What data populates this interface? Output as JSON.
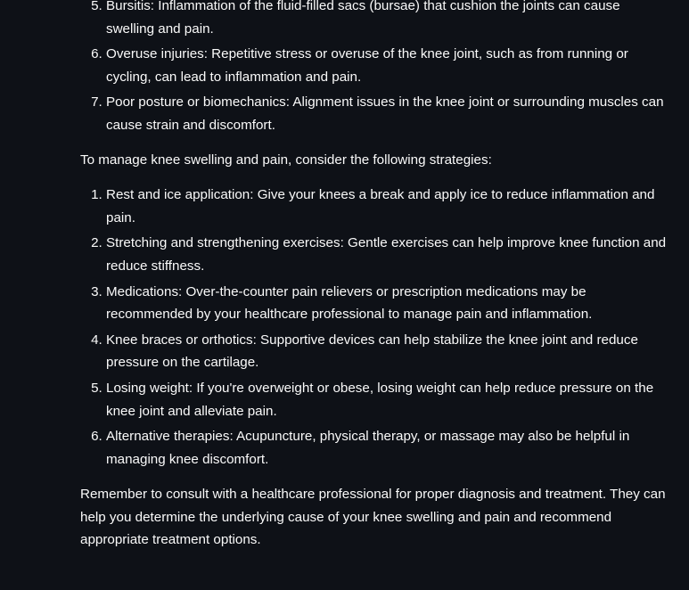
{
  "causes_list": {
    "start": 5,
    "items": [
      "Bursitis: Inflammation of the fluid-filled sacs (bursae) that cushion the joints can cause swelling and pain.",
      "Overuse injuries: Repetitive stress or overuse of the knee joint, such as from running or cycling, can lead to inflammation and pain.",
      "Poor posture or biomechanics: Alignment issues in the knee joint or surrounding muscles can cause strain and discomfort."
    ]
  },
  "strategies_intro": "To manage knee swelling and pain, consider the following strategies:",
  "strategies_list": {
    "items": [
      "Rest and ice application: Give your knees a break and apply ice to reduce inflammation and pain.",
      "Stretching and strengthening exercises: Gentle exercises can help improve knee function and reduce stiffness.",
      "Medications: Over-the-counter pain relievers or prescription medications may be recommended by your healthcare professional to manage pain and inflammation.",
      "Knee braces or orthotics: Supportive devices can help stabilize the knee joint and reduce pressure on the cartilage.",
      "Losing weight: If you're overweight or obese, losing weight can help reduce pressure on the knee joint and alleviate pain.",
      "Alternative therapies: Acupuncture, physical therapy, or massage may also be helpful in managing knee discomfort."
    ]
  },
  "closing": "Remember to consult with a healthcare professional for proper diagnosis and treatment. They can help you determine the underlying cause of your knee swelling and pain and recommend appropriate treatment options."
}
